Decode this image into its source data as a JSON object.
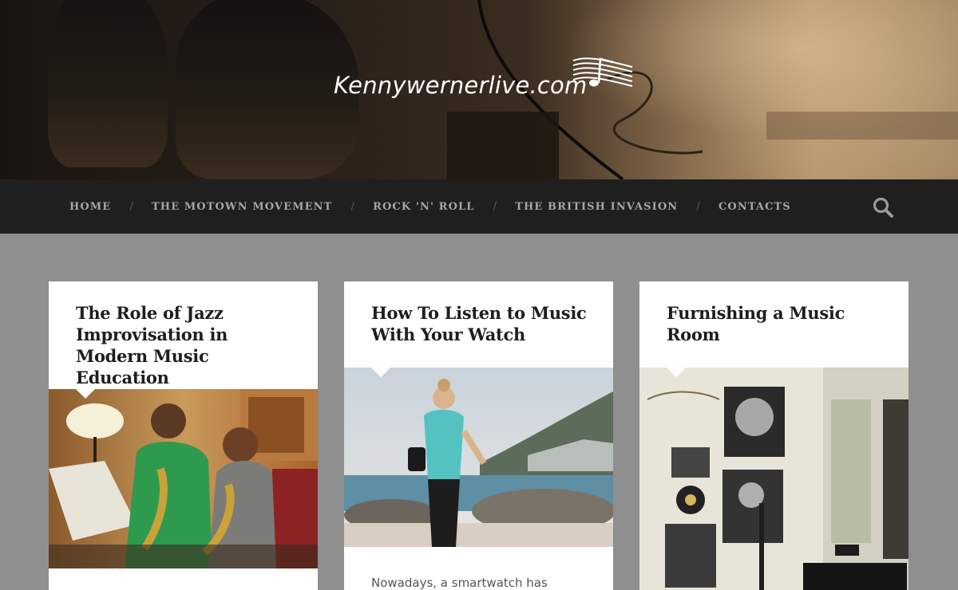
{
  "site": {
    "logo_text": "Kennywernerlive.com"
  },
  "nav": {
    "items": [
      {
        "label": "HOME"
      },
      {
        "label": "THE MOTOWN MOVEMENT"
      },
      {
        "label": "ROCK 'N' ROLL"
      },
      {
        "label": "THE BRITISH INVASION"
      },
      {
        "label": "CONTACTS"
      }
    ],
    "separator": "/",
    "search_icon": "search-icon"
  },
  "posts": [
    {
      "title": "The Role of Jazz Improvisation in Modern Music Education",
      "image_subject": "saxophone-lesson-photo",
      "excerpt": ""
    },
    {
      "title": "How To Listen to Music With Your Watch",
      "image_subject": "woman-with-smartwatch-on-beach-photo",
      "excerpt": "Nowadays, a smartwatch has"
    },
    {
      "title": "Furnishing a Music Room",
      "image_subject": "vintage-music-room-photo",
      "excerpt": ""
    }
  ],
  "colors": {
    "page_background": "#8f8f8f",
    "nav_background": "#1f1f1f",
    "nav_text": "#a6a6a6",
    "card_background": "#ffffff",
    "title_text": "#1e1e1e"
  }
}
